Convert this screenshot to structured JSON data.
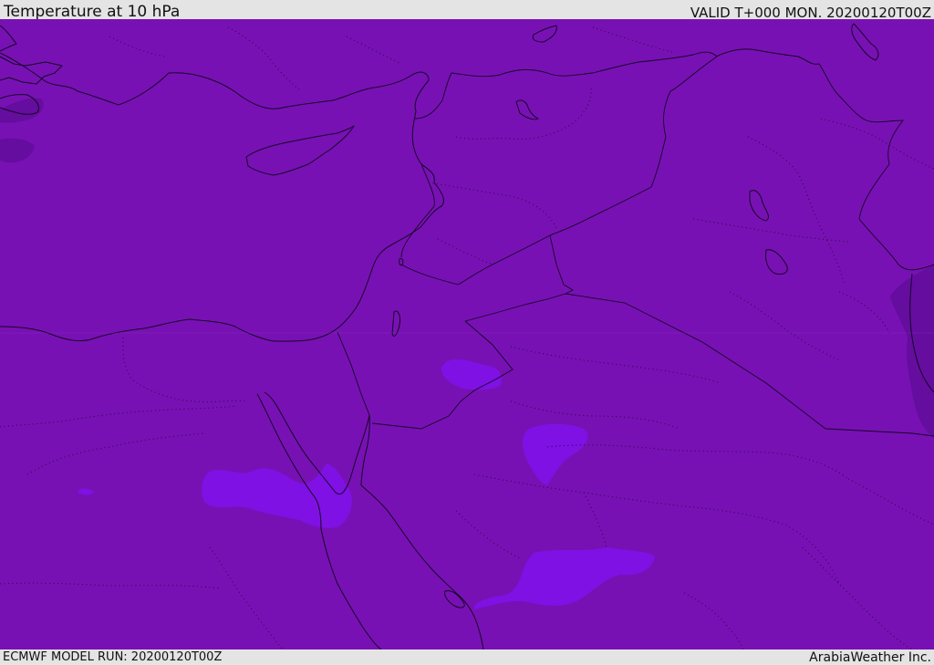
{
  "header": {
    "title": "Temperature at 10 hPa",
    "valid": "VALID T+000 MON. 20200120T00Z"
  },
  "footer": {
    "model_run": "ECMWF MODEL RUN: 20200120T00Z",
    "credit": "ArabiaWeather Inc."
  },
  "colors": {
    "base_fill": "#7811b4",
    "cool_patch": "#7f11e4",
    "dark_patch": "#650d9e",
    "lines": "#150726",
    "frame": "#e4e4e4"
  }
}
